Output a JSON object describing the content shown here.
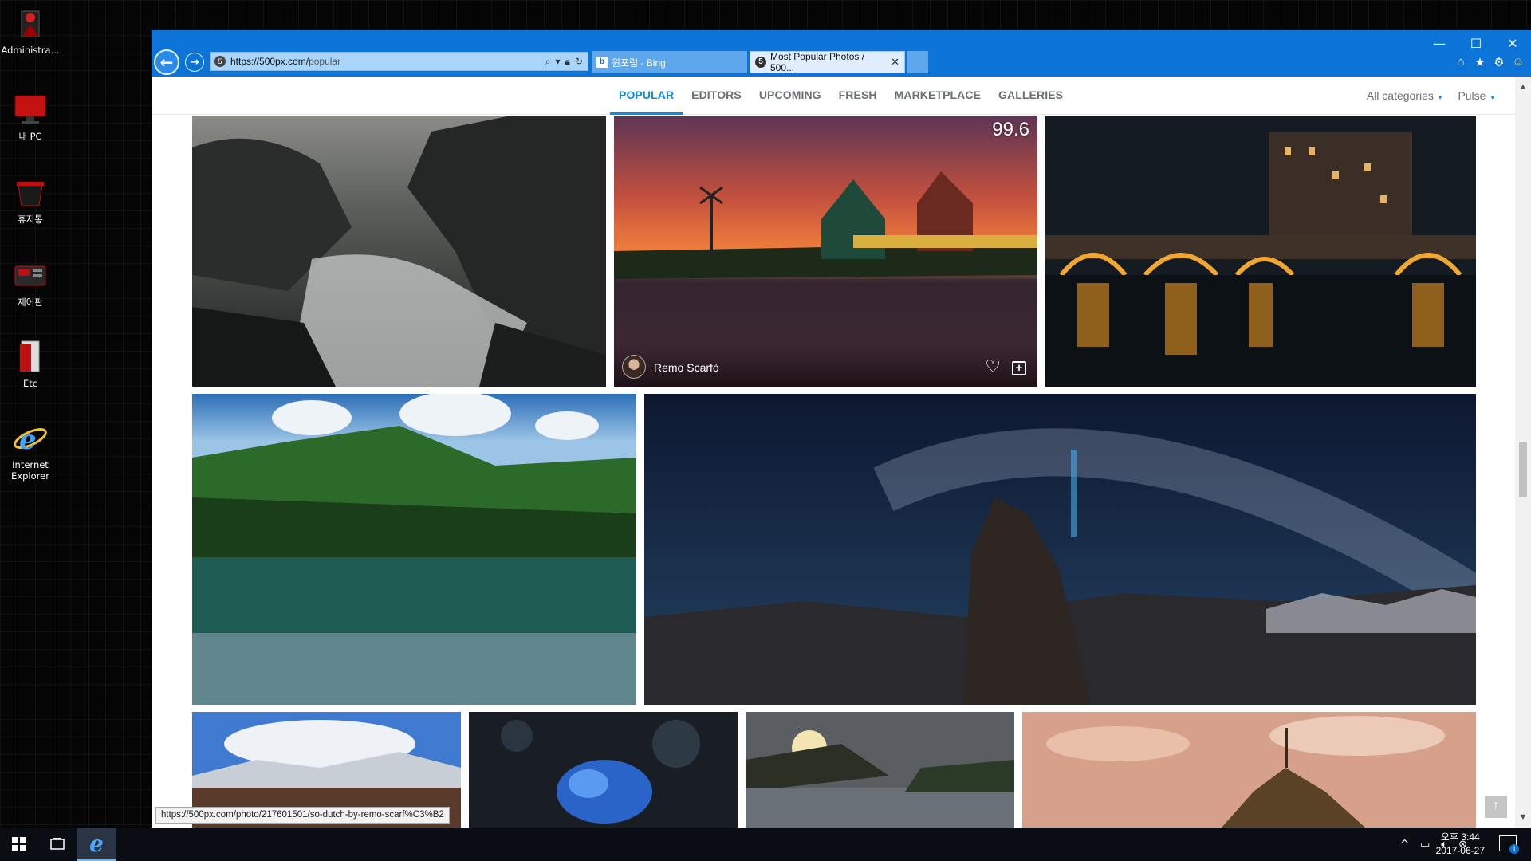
{
  "desktop": {
    "icons": [
      {
        "label": "Administra...",
        "icon": "user-folder-icon"
      },
      {
        "label": "내 PC",
        "icon": "computer-icon"
      },
      {
        "label": "휴지통",
        "icon": "recycle-bin-icon"
      },
      {
        "label": "제어판",
        "icon": "control-panel-icon"
      },
      {
        "label": "Etc",
        "icon": "folder-icon"
      },
      {
        "label": "Internet\nExplorer",
        "icon": "internet-explorer-icon"
      }
    ]
  },
  "browser": {
    "address": {
      "host": "https://500px.com/",
      "path": "popular"
    },
    "tabs": [
      {
        "title": "윈포럼 - Bing",
        "favicon": "bing-icon"
      },
      {
        "title": "Most Popular Photos / 500...",
        "favicon": "500px-icon"
      }
    ],
    "window_controls": {
      "minimize": "—",
      "maximize": "☐",
      "close": "✕"
    }
  },
  "site": {
    "nav_tabs": [
      "POPULAR",
      "EDITORS",
      "UPCOMING",
      "FRESH",
      "MARKETPLACE",
      "GALLERIES"
    ],
    "active_tab": "POPULAR",
    "filters": [
      {
        "label": "All categories"
      },
      {
        "label": "Pulse"
      }
    ],
    "accent_color": "#0b8be6"
  },
  "photos": {
    "featured": {
      "score": "99.6",
      "author": "Remo Scarfò"
    }
  },
  "status_bar": {
    "url": "https://500px.com/photo/217601501/so-dutch-by-remo-scarf%C3%B2"
  },
  "taskbar": {
    "clock_time": "오후 3:44",
    "clock_date": "2017-06-27",
    "notification_count": "1"
  }
}
